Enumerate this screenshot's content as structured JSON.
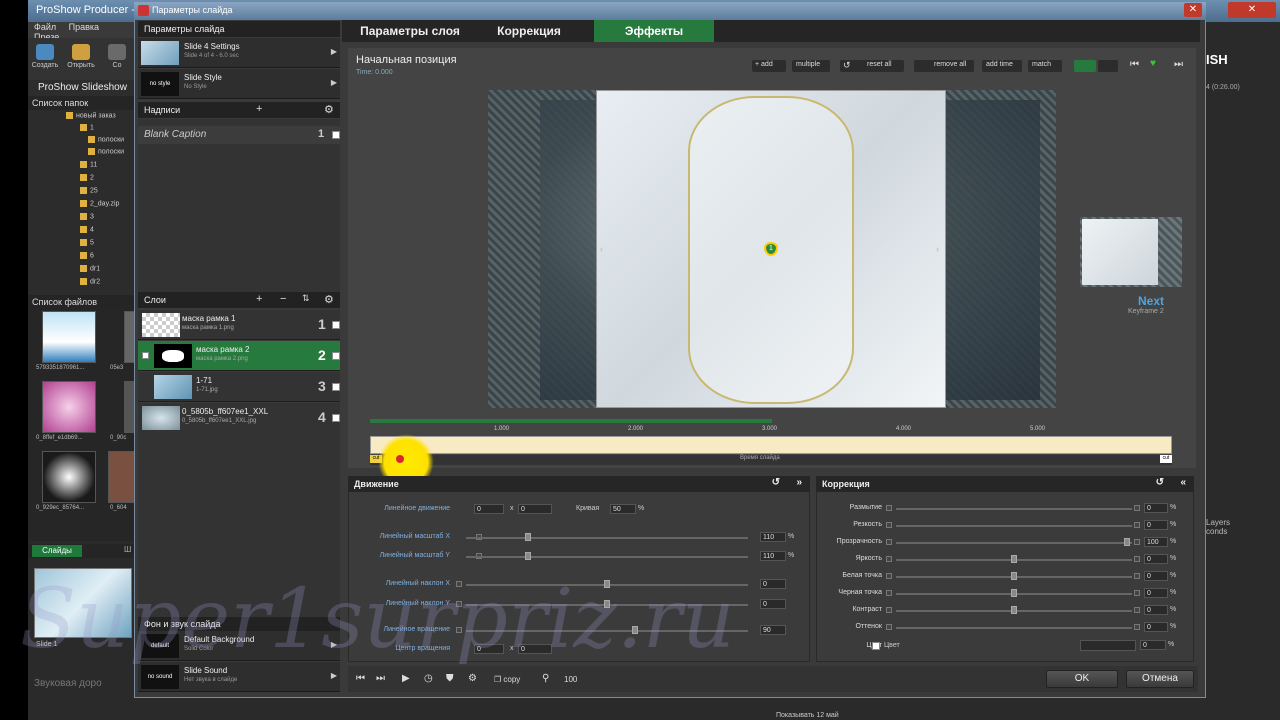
{
  "background_app": {
    "title": "ProShow Producer - Sli",
    "menu": [
      "Файл",
      "Правка",
      "Презе"
    ],
    "toolbar": [
      "Создать",
      "Открыть",
      "Со"
    ],
    "app_name": "ProShow Slideshow",
    "folders_header": "Список папок",
    "folders": [
      "новый заказ",
      "1",
      "полоски",
      "полоски",
      "11",
      "2",
      "25",
      "2_day.zip",
      "3",
      "4",
      "5",
      "6",
      "dr1",
      "dr2"
    ],
    "files_header": "Список файлов",
    "files": [
      "5793351870961...",
      "05e3",
      "0_8ffef_e1db69...",
      "0_90c",
      "0_929ec_85764...",
      "0_604"
    ],
    "slides_tab": "Слайды",
    "slides_tab2": "Ш",
    "slide_label": "Slide 1",
    "sound_track": "Звуковая доро",
    "right_title": "ISH",
    "right_sub": "4 (0:26.00)",
    "right_layers": "Layers\nconds",
    "taskbar_text": "Показывать 12 май"
  },
  "dialog": {
    "title": "Параметры слайда",
    "close": "✕",
    "left": {
      "header": "Параметры слайда",
      "settings_title": "Slide 4 Settings",
      "settings_sub": "Slide 4 of 4 - 6.0 sec",
      "style_icon": "no style",
      "style_title": "Slide Style",
      "style_sub": "No Style",
      "captions_header": "Надписи",
      "caption_item": "Blank Caption",
      "caption_num": "1",
      "layers_header": "Слои",
      "layers": [
        {
          "name": "маска рамка 1",
          "file": "маска рамка 1.png",
          "num": "1"
        },
        {
          "name": "маска рамка 2",
          "file": "маска рамка 2.png",
          "num": "2"
        },
        {
          "name": "1-71",
          "file": "1-71.jpg",
          "num": "3"
        },
        {
          "name": "0_5805b_ff607ee1_XXL",
          "file": "0_5805b_ff607ee1_XXL.jpg",
          "num": "4"
        }
      ],
      "bg_sound_header": "Фон и звук слайда",
      "bg_icon": "default",
      "bg_title": "Default Background",
      "bg_sub": "Solid Color",
      "sound_icon": "no sound",
      "sound_title": "Slide Sound",
      "sound_sub": "Нет звука в слайде"
    },
    "tabs": [
      "Параметры слоя",
      "Коррекция",
      "Эффекты"
    ],
    "preview": {
      "title": "Начальная позиция",
      "time": "Time: 0.000",
      "toolbar": [
        "+ add",
        "multiple",
        "reset all",
        "remove all",
        "add time",
        "match"
      ],
      "next_label": "Next",
      "next_kf": "Keyframe 2",
      "marker": "1"
    },
    "timeline": {
      "ticks": [
        "1.000",
        "2.000",
        "3.000",
        "4.000",
        "5.000"
      ],
      "label": "Время слайда",
      "cut": "cut"
    },
    "motion": {
      "header": "Движение",
      "rows": [
        {
          "label": "Линейное движение",
          "v1": "0",
          "v2": "0",
          "extra_label": "Кривая",
          "extra_val": "50",
          "unit": "%"
        },
        {
          "label": "Линейный масштаб X",
          "val": "110",
          "unit": "%",
          "level": 0.22
        },
        {
          "label": "Линейный масштаб Y",
          "val": "110",
          "unit": "%",
          "level": 0.22
        },
        {
          "label": "Линейный наклон X",
          "val": "0",
          "level": 0.5
        },
        {
          "label": "Линейный наклон Y",
          "val": "0",
          "level": 0.5
        },
        {
          "label": "Линейное вращение",
          "val": "90",
          "level": 0.6
        },
        {
          "label": "Центр вращения",
          "v1": "0",
          "v2": "0"
        }
      ]
    },
    "correction": {
      "header": "Коррекция",
      "rows": [
        {
          "label": "Размытие",
          "val": "0",
          "unit": "%"
        },
        {
          "label": "Резкость",
          "val": "0",
          "unit": "%"
        },
        {
          "label": "Прозрачность",
          "val": "100",
          "unit": "%",
          "level": 0.98
        },
        {
          "label": "Яркость",
          "val": "0",
          "unit": "%",
          "level": 0.5
        },
        {
          "label": "Белая точка",
          "val": "0",
          "unit": "%",
          "level": 0.5
        },
        {
          "label": "Черная точка",
          "val": "0",
          "unit": "%",
          "level": 0.5
        },
        {
          "label": "Контраст",
          "val": "0",
          "unit": "%",
          "level": 0.5
        },
        {
          "label": "Оттенок",
          "val": "0",
          "unit": "%"
        }
      ],
      "color_label": "Цвет",
      "color_label2": "Цвет",
      "color_val": "0",
      "color_unit": "%"
    },
    "bottom": {
      "copy": "copy",
      "zoom": "100",
      "ok": "OK",
      "cancel": "Отмена"
    }
  },
  "watermark": "Super1surpriz.ru",
  "colors": {
    "accent_green": "#267a3e",
    "track": "#f8ebc4",
    "next_blue": "#4fa3e0"
  }
}
